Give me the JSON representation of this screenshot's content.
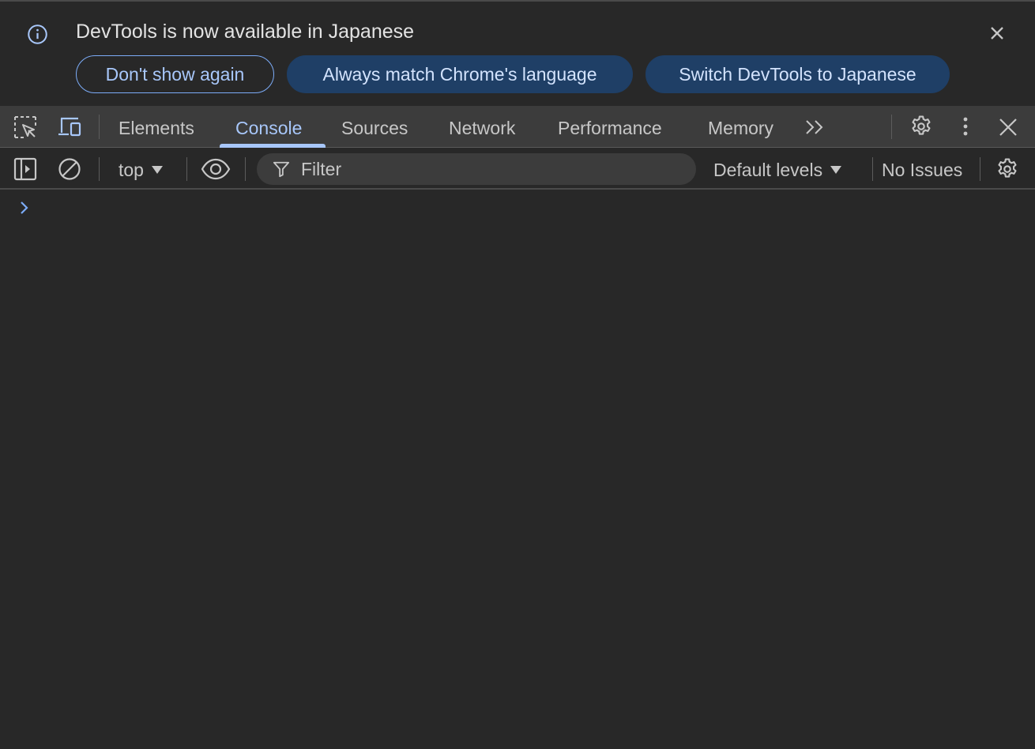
{
  "infobar": {
    "message": "DevTools is now available in Japanese",
    "buttons": {
      "dont_show": "Don't show again",
      "always_match": "Always match Chrome's language",
      "switch": "Switch DevTools to Japanese"
    },
    "icons": {
      "info": "info-icon",
      "close": "close-icon"
    }
  },
  "tabbar": {
    "tabs": [
      {
        "label": "Elements",
        "active": false
      },
      {
        "label": "Console",
        "active": true
      },
      {
        "label": "Sources",
        "active": false
      },
      {
        "label": "Network",
        "active": false
      },
      {
        "label": "Performance",
        "active": false
      },
      {
        "label": "Memory",
        "active": false
      }
    ],
    "icons": [
      "inspect-element-icon",
      "device-toolbar-icon",
      "more-tabs-icon",
      "settings-icon",
      "more-options-icon",
      "close-devtools-icon"
    ]
  },
  "toolbar": {
    "context": "top",
    "filter_placeholder": "Filter",
    "levels": "Default levels",
    "issues": "No Issues",
    "icons": [
      "sidebar-toggle-icon",
      "clear-console-icon",
      "live-expression-icon",
      "filter-icon",
      "console-settings-icon"
    ]
  },
  "colors": {
    "background": "#282828",
    "tabbar": "#3c3c3c",
    "accent": "#a8c7fa",
    "button_fill": "#1f3f66",
    "text": "#e3e3e3"
  }
}
